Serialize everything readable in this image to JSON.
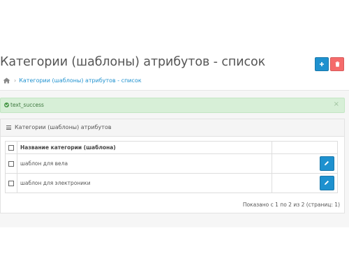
{
  "header": {
    "title": "Категории (шаблоны) атрибутов - список",
    "add_button_icon": "plus-icon",
    "delete_button_icon": "trash-icon"
  },
  "breadcrumb": {
    "home_icon": "home-icon",
    "separator": "›",
    "current": "Категории (шаблоны) атрибутов - список"
  },
  "alert": {
    "text": "text_success",
    "close": "×",
    "color": "#d7efd7"
  },
  "panel": {
    "title": "Категории (шаблоны) атрибутов",
    "table": {
      "header_name": "Название категории (шаблона)",
      "rows": [
        {
          "name": "шаблон для вела"
        },
        {
          "name": "шаблон для электроники"
        }
      ]
    },
    "pagination": "Показано с 1 по 2 из 2 (страниц: 1)"
  },
  "colors": {
    "primary": "#1e91cf",
    "danger": "#f56b6b"
  }
}
